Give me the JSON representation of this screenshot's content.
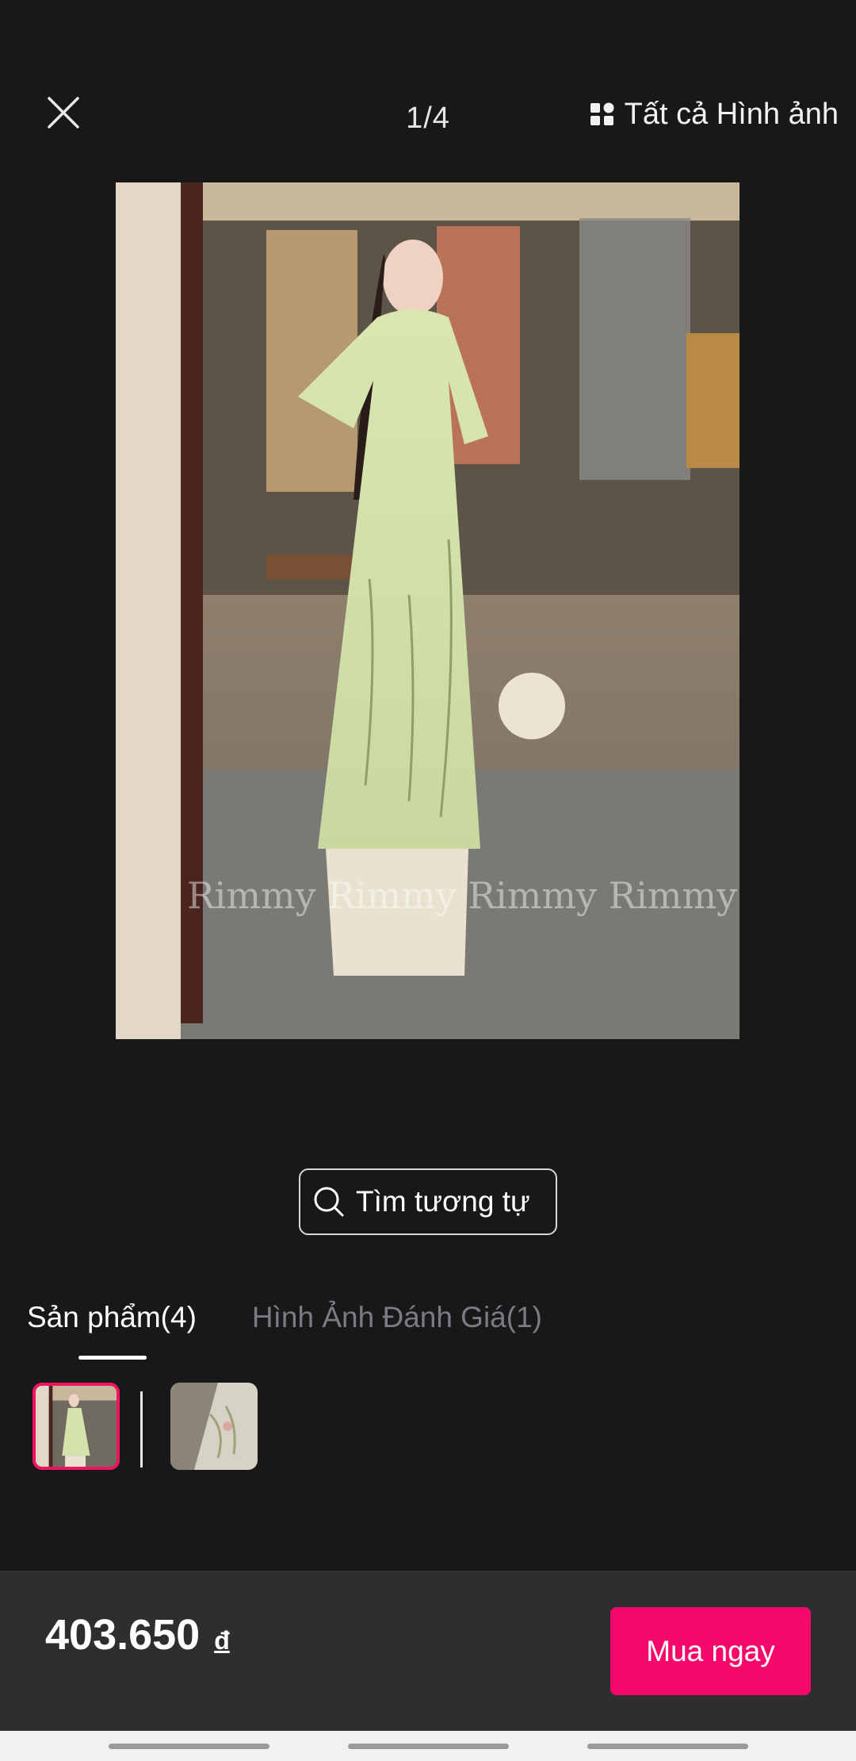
{
  "header": {
    "counter": "1/4",
    "all_images_label": "Tất cả Hình ảnh",
    "close_icon": "close-icon",
    "all_images_icon": "grid-icon"
  },
  "photo": {
    "watermark": "Rimmy Rimmy Rimmy Rimmy"
  },
  "similar": {
    "label": "Tìm tương tự",
    "icon": "search-icon"
  },
  "tabs": [
    {
      "label": "Sản phẩm(4)",
      "active": true
    },
    {
      "label": "Hình Ảnh Đánh Giá(1)",
      "active": false
    }
  ],
  "purchase": {
    "price": "403.650",
    "currency": "đ",
    "buy_label": "Mua ngay",
    "buy_color": "#f6076a"
  },
  "colors": {
    "background": "#181818",
    "bottom_bar": "#2e2e2e",
    "selected_border": "#f0135f"
  }
}
